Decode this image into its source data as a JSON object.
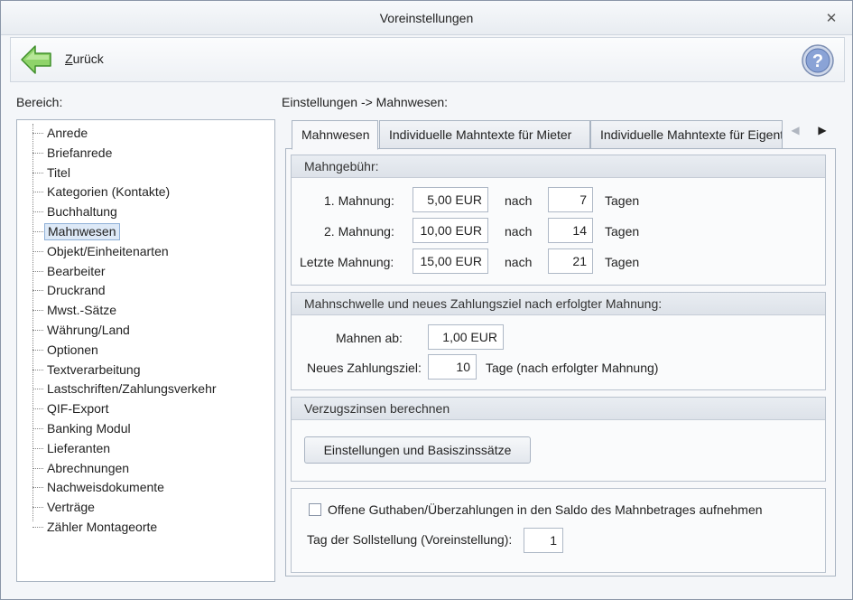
{
  "window": {
    "title": "Voreinstellungen"
  },
  "toolbar": {
    "back_prefix": "Z",
    "back_rest": "urück"
  },
  "labels": {
    "bereich": "Bereich:",
    "breadcrumb": "Einstellungen -> Mahnwesen:"
  },
  "sidebar": {
    "items": [
      {
        "label": "Anrede"
      },
      {
        "label": "Briefanrede"
      },
      {
        "label": "Titel"
      },
      {
        "label": "Kategorien (Kontakte)"
      },
      {
        "label": "Buchhaltung"
      },
      {
        "label": "Mahnwesen"
      },
      {
        "label": "Objekt/Einheitenarten"
      },
      {
        "label": "Bearbeiter"
      },
      {
        "label": "Druckrand"
      },
      {
        "label": "Mwst.-Sätze"
      },
      {
        "label": "Währung/Land"
      },
      {
        "label": "Optionen"
      },
      {
        "label": "Textverarbeitung"
      },
      {
        "label": "Lastschriften/Zahlungsverkehr"
      },
      {
        "label": "QIF-Export"
      },
      {
        "label": "Banking Modul"
      },
      {
        "label": "Lieferanten"
      },
      {
        "label": "Abrechnungen"
      },
      {
        "label": "Nachweisdokumente"
      },
      {
        "label": "Verträge"
      },
      {
        "label": "Zähler Montageorte"
      }
    ],
    "selected": "Mahnwesen"
  },
  "tabs": [
    {
      "label": "Mahnwesen"
    },
    {
      "label": "Individuelle Mahntexte für Mieter"
    },
    {
      "label": "Individuelle Mahntexte für Eigentümer"
    }
  ],
  "mahngebuehr": {
    "title": "Mahngebühr:",
    "nach": "nach",
    "tagen": "Tagen",
    "rows": [
      {
        "label": "1. Mahnung:",
        "amount": "5,00 EUR",
        "days": "7"
      },
      {
        "label": "2. Mahnung:",
        "amount": "10,00 EUR",
        "days": "14"
      },
      {
        "label": "Letzte Mahnung:",
        "amount": "15,00 EUR",
        "days": "21"
      }
    ]
  },
  "mahnschwelle": {
    "title": "Mahnschwelle und neues Zahlungsziel nach erfolgter Mahnung:",
    "mahnen_ab_label": "Mahnen ab:",
    "mahnen_ab_value": "1,00 EUR",
    "zahlungsziel_label": "Neues Zahlungsziel:",
    "zahlungsziel_value": "10",
    "zahlungsziel_suffix": "Tage (nach erfolgter Mahnung)"
  },
  "verzugszinsen": {
    "title": "Verzugszinsen berechnen",
    "button": "Einstellungen und Basiszinssätze"
  },
  "options": {
    "checkbox_label": "Offene Guthaben/Überzahlungen in den Saldo des Mahnbetrages aufnehmen",
    "checkbox_checked": false,
    "sollstellung_label": "Tag der Sollstellung (Voreinstellung):",
    "sollstellung_value": "1"
  }
}
